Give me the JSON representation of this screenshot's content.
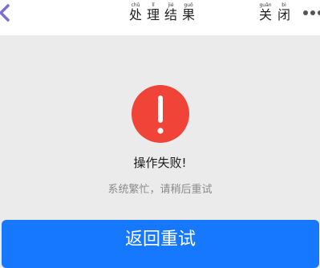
{
  "header": {
    "back_icon": "chevron-left-icon",
    "title": [
      {
        "pinyin": "chǔ",
        "char": "处"
      },
      {
        "pinyin": "lǐ",
        "char": "理"
      },
      {
        "pinyin": "jié",
        "char": "结"
      },
      {
        "pinyin": "guǒ",
        "char": "果"
      }
    ],
    "close": [
      {
        "pinyin": "guān",
        "char": "关"
      },
      {
        "pinyin": "bì",
        "char": "闭"
      }
    ],
    "more_icon": "more-dots-icon"
  },
  "main": {
    "status_icon": "error-exclamation-icon",
    "title": "操作失败!",
    "message": "系统繁忙，请稍后重试",
    "retry_label": "返回重试"
  },
  "colors": {
    "accent": "#1677ff",
    "error": "#f04438",
    "back_chevron": "#7b6fd6",
    "background": "#ebebeb"
  }
}
